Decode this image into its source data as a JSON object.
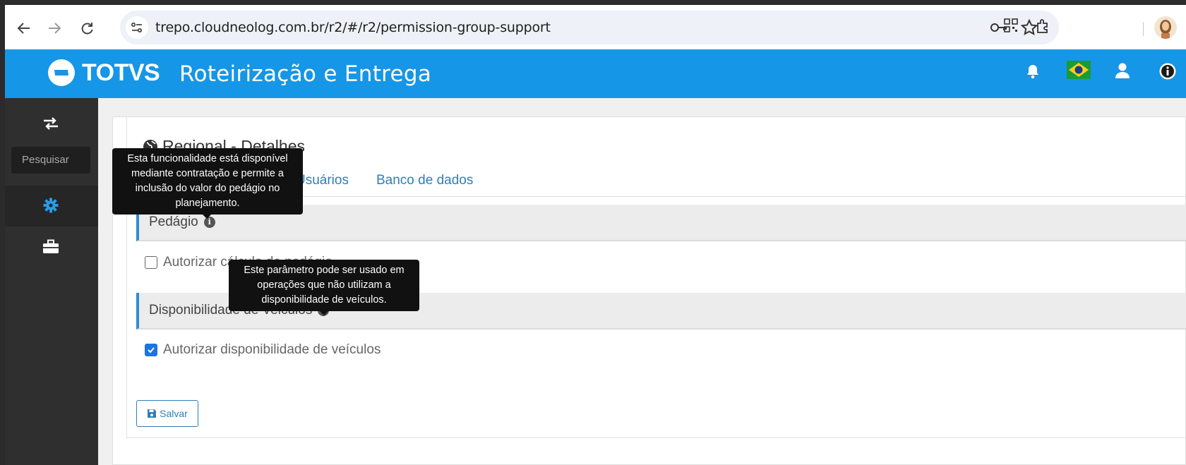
{
  "browser": {
    "url": "trepo.cloudneolog.com.br/r2/#/r2/permission-group-support"
  },
  "header": {
    "logo_text": "TOTVS",
    "app_title": "Roteirização e Entrega"
  },
  "sidebar": {
    "search_placeholder": "Pesquisar"
  },
  "main": {
    "page_title": "Regional - Detalhes",
    "tabs": [
      {
        "label": "Usuários"
      },
      {
        "label": "Banco de dados"
      }
    ],
    "sections": [
      {
        "title": "Pedágio",
        "tooltip": "Esta funcionalidade está disponível mediante contratação e permite a inclusão do valor do pedágio no planejamento.",
        "checkbox_label": "Autorizar cálculo de pedágio",
        "checked": false
      },
      {
        "title": "Disponibilidade de Veiculos",
        "tooltip": "Este parâmetro pode ser usado em operações que não utilizam a disponibilidade de veículos.",
        "checkbox_label": "Autorizar disponibilidade de veículos",
        "checked": true
      }
    ],
    "save_label": "Salvar"
  },
  "colors": {
    "header_bg": "#1696e6",
    "sidebar_bg": "#2f2f2f",
    "accent": "#2e7fb8",
    "section_border": "#2a8fd4"
  }
}
